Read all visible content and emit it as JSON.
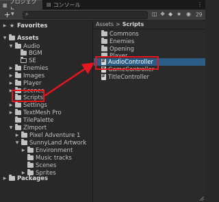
{
  "tabs": [
    {
      "label": "プロジェクト",
      "active": true
    },
    {
      "label": "コンソール",
      "active": false
    }
  ],
  "toolbar": {
    "add_label": "+",
    "search_value": "",
    "search_placeholder": "",
    "hidden_count": "29"
  },
  "left_panel": {
    "favorites_label": "Favorites",
    "assets_label": "Assets",
    "packages_label": "Packages",
    "tree": [
      {
        "label": "Audio"
      },
      {
        "label": "BGM"
      },
      {
        "label": "SE"
      },
      {
        "label": "Enemies"
      },
      {
        "label": "Images"
      },
      {
        "label": "Player"
      },
      {
        "label": "Scenes"
      },
      {
        "label": "Scripts"
      },
      {
        "label": "Settings"
      },
      {
        "label": "TextMesh Pro"
      },
      {
        "label": "TilePalette"
      },
      {
        "label": "ZImport"
      },
      {
        "label": "Pixel Adventure 1"
      },
      {
        "label": "SunnyLand Artwork"
      },
      {
        "label": "Environment"
      },
      {
        "label": "Music tracks"
      },
      {
        "label": "Scenes"
      },
      {
        "label": "Sprites"
      }
    ]
  },
  "right_panel": {
    "breadcrumb": [
      "Assets",
      "Scripts"
    ],
    "folders": [
      "Commons",
      "Enemies",
      "Opening",
      "Player"
    ],
    "scripts": [
      "AudioController",
      "GameController",
      "TitleController"
    ]
  },
  "colors": {
    "selection": "#2c5d87",
    "highlight": "#e8141e"
  }
}
